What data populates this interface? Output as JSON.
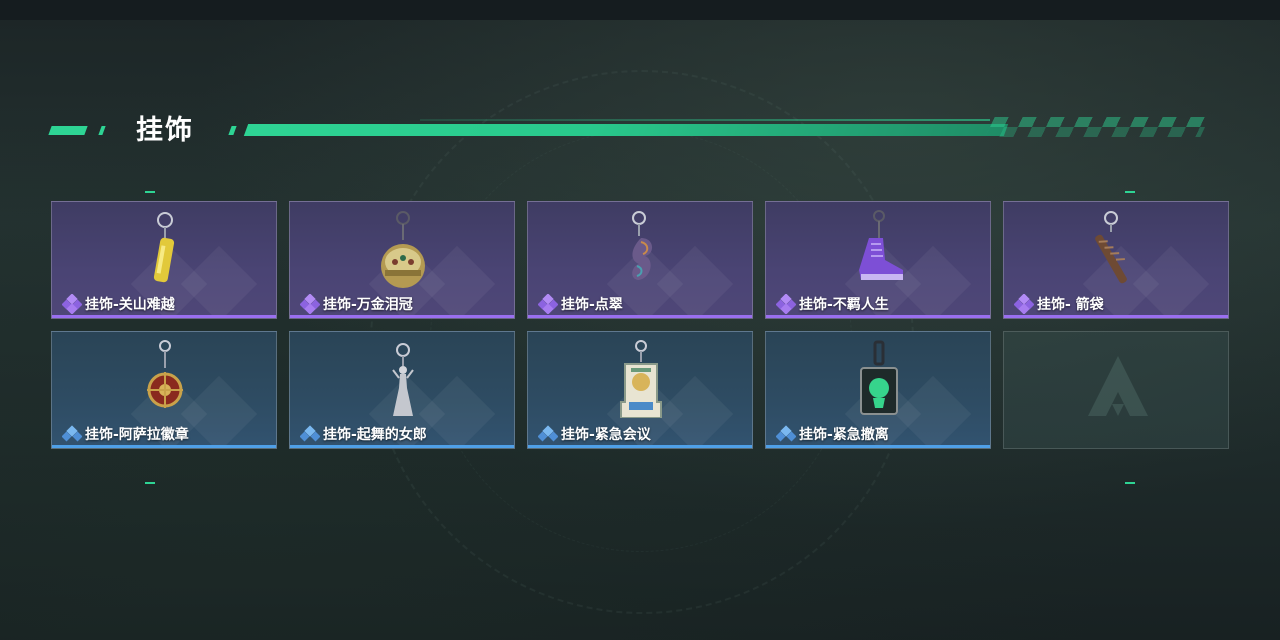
{
  "section": {
    "title": "挂饰"
  },
  "items": [
    {
      "label": "挂饰-关山难越",
      "rarity": "purple",
      "icon": "gold-cylinder-charm-icon"
    },
    {
      "label": "挂饰-万金泪冠",
      "rarity": "purple",
      "icon": "jeweled-crown-charm-icon"
    },
    {
      "label": "挂饰-点翠",
      "rarity": "purple",
      "icon": "phoenix-charm-icon"
    },
    {
      "label": "挂饰-不羁人生",
      "rarity": "purple",
      "icon": "purple-sneaker-charm-icon"
    },
    {
      "label": "挂饰- 箭袋",
      "rarity": "purple",
      "icon": "quiver-charm-icon"
    },
    {
      "label": "挂饰-阿萨拉徽章",
      "rarity": "blue",
      "icon": "badge-charm-icon"
    },
    {
      "label": "挂饰-起舞的女郎",
      "rarity": "blue",
      "icon": "dancer-charm-icon"
    },
    {
      "label": "挂饰-紧急会议",
      "rarity": "blue",
      "icon": "meeting-charm-icon"
    },
    {
      "label": "挂饰-紧急撤离",
      "rarity": "blue",
      "icon": "evac-charm-icon"
    }
  ],
  "colors": {
    "accent": "#2ed494",
    "purple_rarity": "#9a6ff0",
    "blue_rarity": "#4fa0e8"
  }
}
